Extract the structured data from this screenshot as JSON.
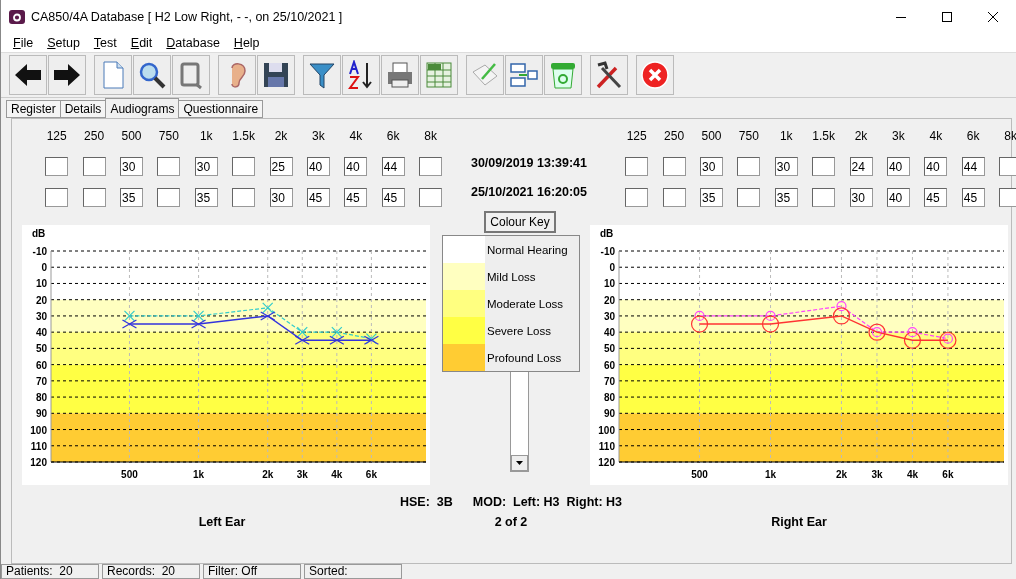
{
  "window": {
    "title": "CA850/4A Database [ H2 Low Right, - -, on 25/10/2021 ]"
  },
  "menu": [
    "File",
    "Setup",
    "Test",
    "Edit",
    "Database",
    "Help"
  ],
  "tabs": [
    {
      "label": "Register",
      "selected": false
    },
    {
      "label": "Details",
      "selected": false
    },
    {
      "label": "Audiograms",
      "selected": true
    },
    {
      "label": "Questionnaire",
      "selected": false
    }
  ],
  "left_frequencies": [
    "125",
    "250",
    "500",
    "750",
    "1k",
    "1.5k",
    "2k",
    "3k",
    "4k",
    "6k",
    "8k"
  ],
  "right_frequencies": [
    "125",
    "250",
    "500",
    "750",
    "1k",
    "1.5k",
    "2k",
    "3k",
    "4k",
    "6k",
    "8k"
  ],
  "sessions": [
    {
      "date": "30/09/2019 13:39:41",
      "left": [
        {
          "empty": true
        },
        {
          "empty": true
        },
        {
          "value": "30"
        },
        {
          "empty": true
        },
        {
          "value": "30"
        },
        {
          "empty": true
        },
        {
          "value": "25"
        },
        {
          "value": "40"
        },
        {
          "value": "40"
        },
        {
          "value": "44"
        },
        {
          "empty": true
        }
      ],
      "right": [
        {
          "empty": true
        },
        {
          "empty": true
        },
        {
          "value": "30"
        },
        {
          "empty": true
        },
        {
          "value": "30"
        },
        {
          "empty": true
        },
        {
          "value": "24"
        },
        {
          "value": "40"
        },
        {
          "value": "40"
        },
        {
          "value": "44"
        },
        {
          "empty": true
        }
      ]
    },
    {
      "date": "25/10/2021 16:20:05",
      "left": [
        {
          "empty": true
        },
        {
          "empty": true
        },
        {
          "value": "35"
        },
        {
          "empty": true
        },
        {
          "value": "35"
        },
        {
          "empty": true
        },
        {
          "value": "30"
        },
        {
          "value": "45"
        },
        {
          "value": "45"
        },
        {
          "value": "45"
        },
        {
          "empty": true
        }
      ],
      "right": [
        {
          "empty": true
        },
        {
          "empty": true
        },
        {
          "value": "35"
        },
        {
          "empty": true
        },
        {
          "value": "35"
        },
        {
          "empty": true
        },
        {
          "value": "30"
        },
        {
          "value": "40"
        },
        {
          "value": "45"
        },
        {
          "value": "45"
        },
        {
          "empty": true
        }
      ]
    }
  ],
  "colour_key": {
    "button": "Colour Key",
    "items": [
      {
        "label": "Normal Hearing",
        "color": "#ffffff"
      },
      {
        "label": "Mild Loss",
        "color": "#ffffc0"
      },
      {
        "label": "Moderate Loss",
        "color": "#ffff80"
      },
      {
        "label": "Severe Loss",
        "color": "#ffff44"
      },
      {
        "label": "Profound Loss",
        "color": "#ffcc33"
      }
    ]
  },
  "charts": [
    {
      "label": "Left Ear",
      "chart_data": {
        "type": "line",
        "ylabel": "dB",
        "categories": [
          null,
          null,
          "500",
          null,
          "1k",
          null,
          "2k",
          "3k",
          "4k",
          "6k",
          null
        ],
        "ylim": [
          120,
          -10
        ],
        "grid": true,
        "yticks": [
          -10,
          0,
          10,
          20,
          30,
          40,
          50,
          60,
          70,
          80,
          90,
          100,
          110,
          120
        ],
        "bands": [
          {
            "axis": "y",
            "from": 20,
            "to": 40,
            "color": "#ffffc0"
          },
          {
            "axis": "y",
            "from": 40,
            "to": 60,
            "color": "#ffff80"
          },
          {
            "axis": "y",
            "from": 60,
            "to": 90,
            "color": "#ffff44"
          },
          {
            "axis": "y",
            "from": 90,
            "to": 120,
            "color": "#ffcc33"
          }
        ],
        "series": [
          {
            "color": "#33cccc",
            "line_style": "dashed",
            "marker": "x",
            "values": [
              null,
              null,
              30,
              null,
              30,
              null,
              25,
              40,
              40,
              44,
              null
            ]
          },
          {
            "color": "#3333dd",
            "line_style": "solid",
            "marker": "x",
            "values": [
              null,
              null,
              35,
              null,
              35,
              null,
              30,
              45,
              45,
              45,
              null
            ]
          }
        ]
      }
    },
    {
      "label": "Right Ear",
      "chart_data": {
        "type": "line",
        "ylabel": "dB",
        "categories": [
          null,
          null,
          "500",
          null,
          "1k",
          null,
          "2k",
          "3k",
          "4k",
          "6k",
          null
        ],
        "ylim": [
          120,
          -10
        ],
        "grid": true,
        "yticks": [
          -10,
          0,
          10,
          20,
          30,
          40,
          50,
          60,
          70,
          80,
          90,
          100,
          110,
          120
        ],
        "bands": [
          {
            "axis": "y",
            "from": 20,
            "to": 40,
            "color": "#ffffc0"
          },
          {
            "axis": "y",
            "from": 40,
            "to": 60,
            "color": "#ffff80"
          },
          {
            "axis": "y",
            "from": 60,
            "to": 90,
            "color": "#ffff44"
          },
          {
            "axis": "y",
            "from": 90,
            "to": 120,
            "color": "#ffcc33"
          }
        ],
        "series": [
          {
            "color": "#ff44ff",
            "line_style": "dashed",
            "marker": "o",
            "values": [
              null,
              null,
              30,
              null,
              30,
              null,
              24,
              40,
              40,
              44,
              null
            ]
          },
          {
            "color": "#ff3333",
            "line_style": "solid",
            "marker": "o",
            "values": [
              null,
              null,
              35,
              null,
              35,
              null,
              30,
              40,
              45,
              45,
              null
            ]
          }
        ]
      }
    }
  ],
  "summary": {
    "hse": "HSE:  3B",
    "mod": "MOD:  Left: H3  Right: H3",
    "record": "2 of 2"
  },
  "status_bar": [
    "Patients:  20",
    "Records:  20",
    "Filter: Off",
    "Sorted:"
  ]
}
